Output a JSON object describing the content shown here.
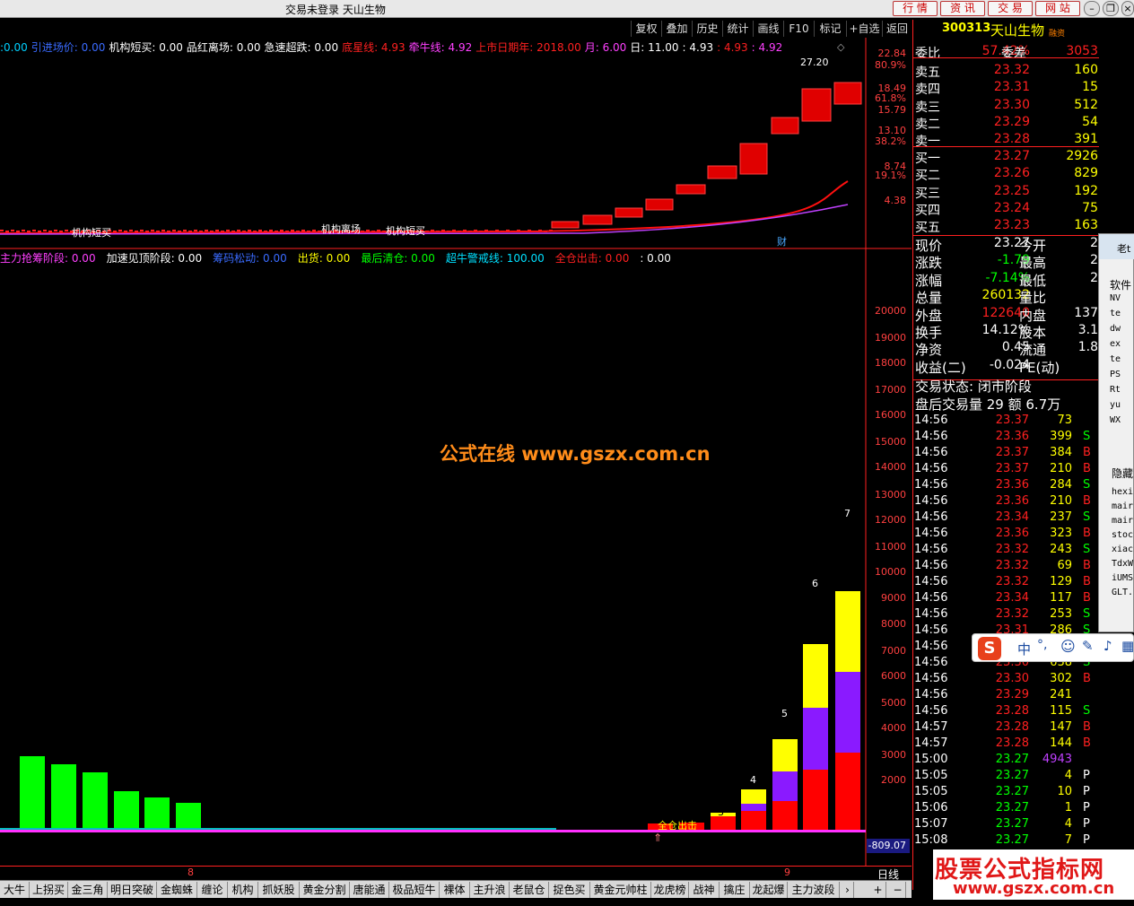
{
  "window": {
    "title": "交易未登录  天山生物"
  },
  "top_buttons": [
    "行 情",
    "资 讯",
    "交 易",
    "网 站"
  ],
  "toolbar": [
    "复权",
    "叠加",
    "历史",
    "统计",
    "画线",
    "F10",
    "标记",
    "+自选",
    "返回"
  ],
  "main_indicators": [
    {
      "text": ":0.00",
      "color": "#00d0ff"
    },
    {
      "text": "引进场价: 0.00",
      "color": "#3a6bff"
    },
    {
      "text": "机构短买: 0.00",
      "color": "#ffffff"
    },
    {
      "text": "品红离场: 0.00",
      "color": "#ffffff"
    },
    {
      "text": "急速超跌: 0.00",
      "color": "#ffffff"
    },
    {
      "text": "底星线: 4.93",
      "color": "#ff2020"
    },
    {
      "text": "牵牛线: 4.92",
      "color": "#ff40ff"
    },
    {
      "text": "上市日期年: 2018.00",
      "color": "#ff2020"
    },
    {
      "text": "月: 6.00",
      "color": "#ff40ff"
    },
    {
      "text": "日: 11.00",
      "color": "#ffffff"
    },
    {
      "text": ": 4.93",
      "color": "#ffffff"
    },
    {
      "text": ": 4.93",
      "color": "#ff2020"
    },
    {
      "text": ": 4.92",
      "color": "#ff40ff"
    }
  ],
  "main_axis": [
    "22.84",
    "80.9%",
    "18.49",
    "61.8%",
    "15.79",
    "13.10",
    "38.2%",
    "8.74",
    "19.1%",
    "4.38"
  ],
  "price_peak_label": "27.20",
  "main_annotations": [
    "机构短买",
    "机构离场",
    "机构短买",
    "财"
  ],
  "sub_indicators": [
    {
      "text": "主力抢筹阶段: 0.00",
      "color": "#ff40ff"
    },
    {
      "text": "加速见顶阶段: 0.00",
      "color": "#ffffff"
    },
    {
      "text": "筹码松动: 0.00",
      "color": "#3a6bff"
    },
    {
      "text": "出货: 0.00",
      "color": "#ffff00"
    },
    {
      "text": "最后清仓: 0.00",
      "color": "#00ff00"
    },
    {
      "text": "超牛警戒线: 100.00",
      "color": "#00e0ff"
    },
    {
      "text": "全仓出击: 0.00",
      "color": "#ff2020"
    },
    {
      "text": ": 0.00",
      "color": "#ffffff"
    }
  ],
  "sub_axis": [
    "20000",
    "19000",
    "18000",
    "17000",
    "16000",
    "15000",
    "14000",
    "13000",
    "12000",
    "11000",
    "10000",
    "9000",
    "8000",
    "7000",
    "6000",
    "5000",
    "4000",
    "3000",
    "2000"
  ],
  "sub_axis_bottom": "-809.07",
  "bar_numbers": [
    "3",
    "4",
    "5",
    "6",
    "7"
  ],
  "sub_annotation": "全仓出击",
  "date_markers": [
    "8",
    "9"
  ],
  "period_label": "日线",
  "watermark_center": "公式在线  www.gszx.com.cn",
  "watermark_corner": {
    "line1": "股票公式指标网",
    "line2": "www.gszx.com.cn"
  },
  "quote": {
    "code": "300313",
    "name": "天山生物",
    "tag": "融资",
    "weibi_label": "委比",
    "weibi_value": "57.42%",
    "weicha_label": "委差",
    "weicha_value": "3053",
    "asks": [
      {
        "label": "卖五",
        "price": "23.32",
        "vol": "160"
      },
      {
        "label": "卖四",
        "price": "23.31",
        "vol": "15"
      },
      {
        "label": "卖三",
        "price": "23.30",
        "vol": "512"
      },
      {
        "label": "卖二",
        "price": "23.29",
        "vol": "54"
      },
      {
        "label": "卖一",
        "price": "23.28",
        "vol": "391"
      }
    ],
    "bids": [
      {
        "label": "买一",
        "price": "23.27",
        "vol": "2926"
      },
      {
        "label": "买二",
        "price": "23.26",
        "vol": "829"
      },
      {
        "label": "买三",
        "price": "23.25",
        "vol": "192"
      },
      {
        "label": "买四",
        "price": "23.24",
        "vol": "75"
      },
      {
        "label": "买五",
        "price": "23.23",
        "vol": "163"
      }
    ],
    "stats": [
      {
        "l1": "现价",
        "v1": "23.27",
        "c1": "#ffffff",
        "l2": "今开",
        "v2": "2"
      },
      {
        "l1": "涨跌",
        "v1": "-1.79",
        "c1": "#00ff00",
        "l2": "最高",
        "v2": "2"
      },
      {
        "l1": "涨幅",
        "v1": "-7.14%",
        "c1": "#00ff00",
        "l2": "最低",
        "v2": "2"
      },
      {
        "l1": "总量",
        "v1": "260132",
        "c1": "#ffff00",
        "l2": "量比",
        "v2": ""
      },
      {
        "l1": "外盘",
        "v1": "122640",
        "c1": "#ff2020",
        "l2": "内盘",
        "v2": "137"
      },
      {
        "l1": "换手",
        "v1": "14.12%",
        "c1": "#ffffff",
        "l2": "股本",
        "v2": "3.1"
      },
      {
        "l1": "净资",
        "v1": "0.45",
        "c1": "#ffffff",
        "l2": "流通",
        "v2": "1.8"
      },
      {
        "l1": "收益(二)",
        "v1": "-0.024",
        "c1": "#ffffff",
        "l2": "PE(动)",
        "v2": ""
      }
    ],
    "trade_status": "交易状态: 闭市阶段",
    "after_hours": "盘后交易量 29 额 6.7万"
  },
  "ticks": [
    {
      "t": "14:56",
      "p": "23.37",
      "v": "73",
      "bs": "",
      "pc": "#ff2020"
    },
    {
      "t": "14:56",
      "p": "23.36",
      "v": "399",
      "bs": "S",
      "pc": "#ff2020"
    },
    {
      "t": "14:56",
      "p": "23.37",
      "v": "384",
      "bs": "B",
      "pc": "#ff2020"
    },
    {
      "t": "14:56",
      "p": "23.37",
      "v": "210",
      "bs": "B",
      "pc": "#ff2020"
    },
    {
      "t": "14:56",
      "p": "23.36",
      "v": "284",
      "bs": "S",
      "pc": "#ff2020"
    },
    {
      "t": "14:56",
      "p": "23.36",
      "v": "210",
      "bs": "B",
      "pc": "#ff2020"
    },
    {
      "t": "14:56",
      "p": "23.34",
      "v": "237",
      "bs": "S",
      "pc": "#ff2020"
    },
    {
      "t": "14:56",
      "p": "23.36",
      "v": "323",
      "bs": "B",
      "pc": "#ff2020"
    },
    {
      "t": "14:56",
      "p": "23.32",
      "v": "243",
      "bs": "S",
      "pc": "#ff2020"
    },
    {
      "t": "14:56",
      "p": "23.32",
      "v": "69",
      "bs": "B",
      "pc": "#ff2020"
    },
    {
      "t": "14:56",
      "p": "23.32",
      "v": "129",
      "bs": "B",
      "pc": "#ff2020"
    },
    {
      "t": "14:56",
      "p": "23.34",
      "v": "117",
      "bs": "B",
      "pc": "#ff2020"
    },
    {
      "t": "14:56",
      "p": "23.32",
      "v": "253",
      "bs": "S",
      "pc": "#ff2020"
    },
    {
      "t": "14:56",
      "p": "23.31",
      "v": "286",
      "bs": "S",
      "pc": "#ff2020"
    },
    {
      "t": "14:56",
      "p": "",
      "v": "",
      "bs": "",
      "pc": "#ff2020"
    },
    {
      "t": "14:56",
      "p": "23.30",
      "v": "638",
      "bs": "S",
      "pc": "#ff2020"
    },
    {
      "t": "14:56",
      "p": "23.30",
      "v": "302",
      "bs": "B",
      "pc": "#ff2020"
    },
    {
      "t": "14:56",
      "p": "23.29",
      "v": "241",
      "bs": "",
      "pc": "#ff2020"
    },
    {
      "t": "14:56",
      "p": "23.28",
      "v": "115",
      "bs": "S",
      "pc": "#ff2020"
    },
    {
      "t": "14:57",
      "p": "23.28",
      "v": "147",
      "bs": "B",
      "pc": "#ff2020"
    },
    {
      "t": "14:57",
      "p": "23.28",
      "v": "144",
      "bs": "B",
      "pc": "#ff2020"
    },
    {
      "t": "15:00",
      "p": "23.27",
      "v": "4943",
      "bs": "",
      "pc": "#00ff00"
    },
    {
      "t": "15:05",
      "p": "23.27",
      "v": "4",
      "bs": "P",
      "pc": "#00ff00"
    },
    {
      "t": "15:05",
      "p": "23.27",
      "v": "10",
      "bs": "P",
      "pc": "#00ff00"
    },
    {
      "t": "15:06",
      "p": "23.27",
      "v": "1",
      "bs": "P",
      "pc": "#00ff00"
    },
    {
      "t": "15:07",
      "p": "23.27",
      "v": "4",
      "bs": "P",
      "pc": "#00ff00"
    },
    {
      "t": "15:08",
      "p": "23.27",
      "v": "7",
      "bs": "P",
      "pc": "#00ff00"
    }
  ],
  "bottom_tabs": [
    "大牛",
    "上拐买",
    "金三角",
    "明日突破",
    "金蜘蛛",
    "缠论",
    "机构",
    "抓妖股",
    "黄金分割",
    "唐能通",
    "极品短牛",
    "裸体",
    "主升浪",
    "老鼠仓",
    "捉色买",
    "黄金元帅柱",
    "龙虎榜",
    "战神",
    "擒庄",
    "龙起爆",
    "主力波段"
  ],
  "side_panel": {
    "title": "老t",
    "header": "软件",
    "items": [
      "NV",
      "te",
      "dw",
      "ex",
      "te",
      "PS",
      "Rt",
      "yu",
      "WX"
    ],
    "hidden_label": "隐藏",
    "files": [
      "hexi",
      "mair",
      "mair",
      "stoc",
      "xiac",
      "TdxW",
      "iUMS",
      "GLT."
    ]
  },
  "ime": {
    "label": "中"
  }
}
